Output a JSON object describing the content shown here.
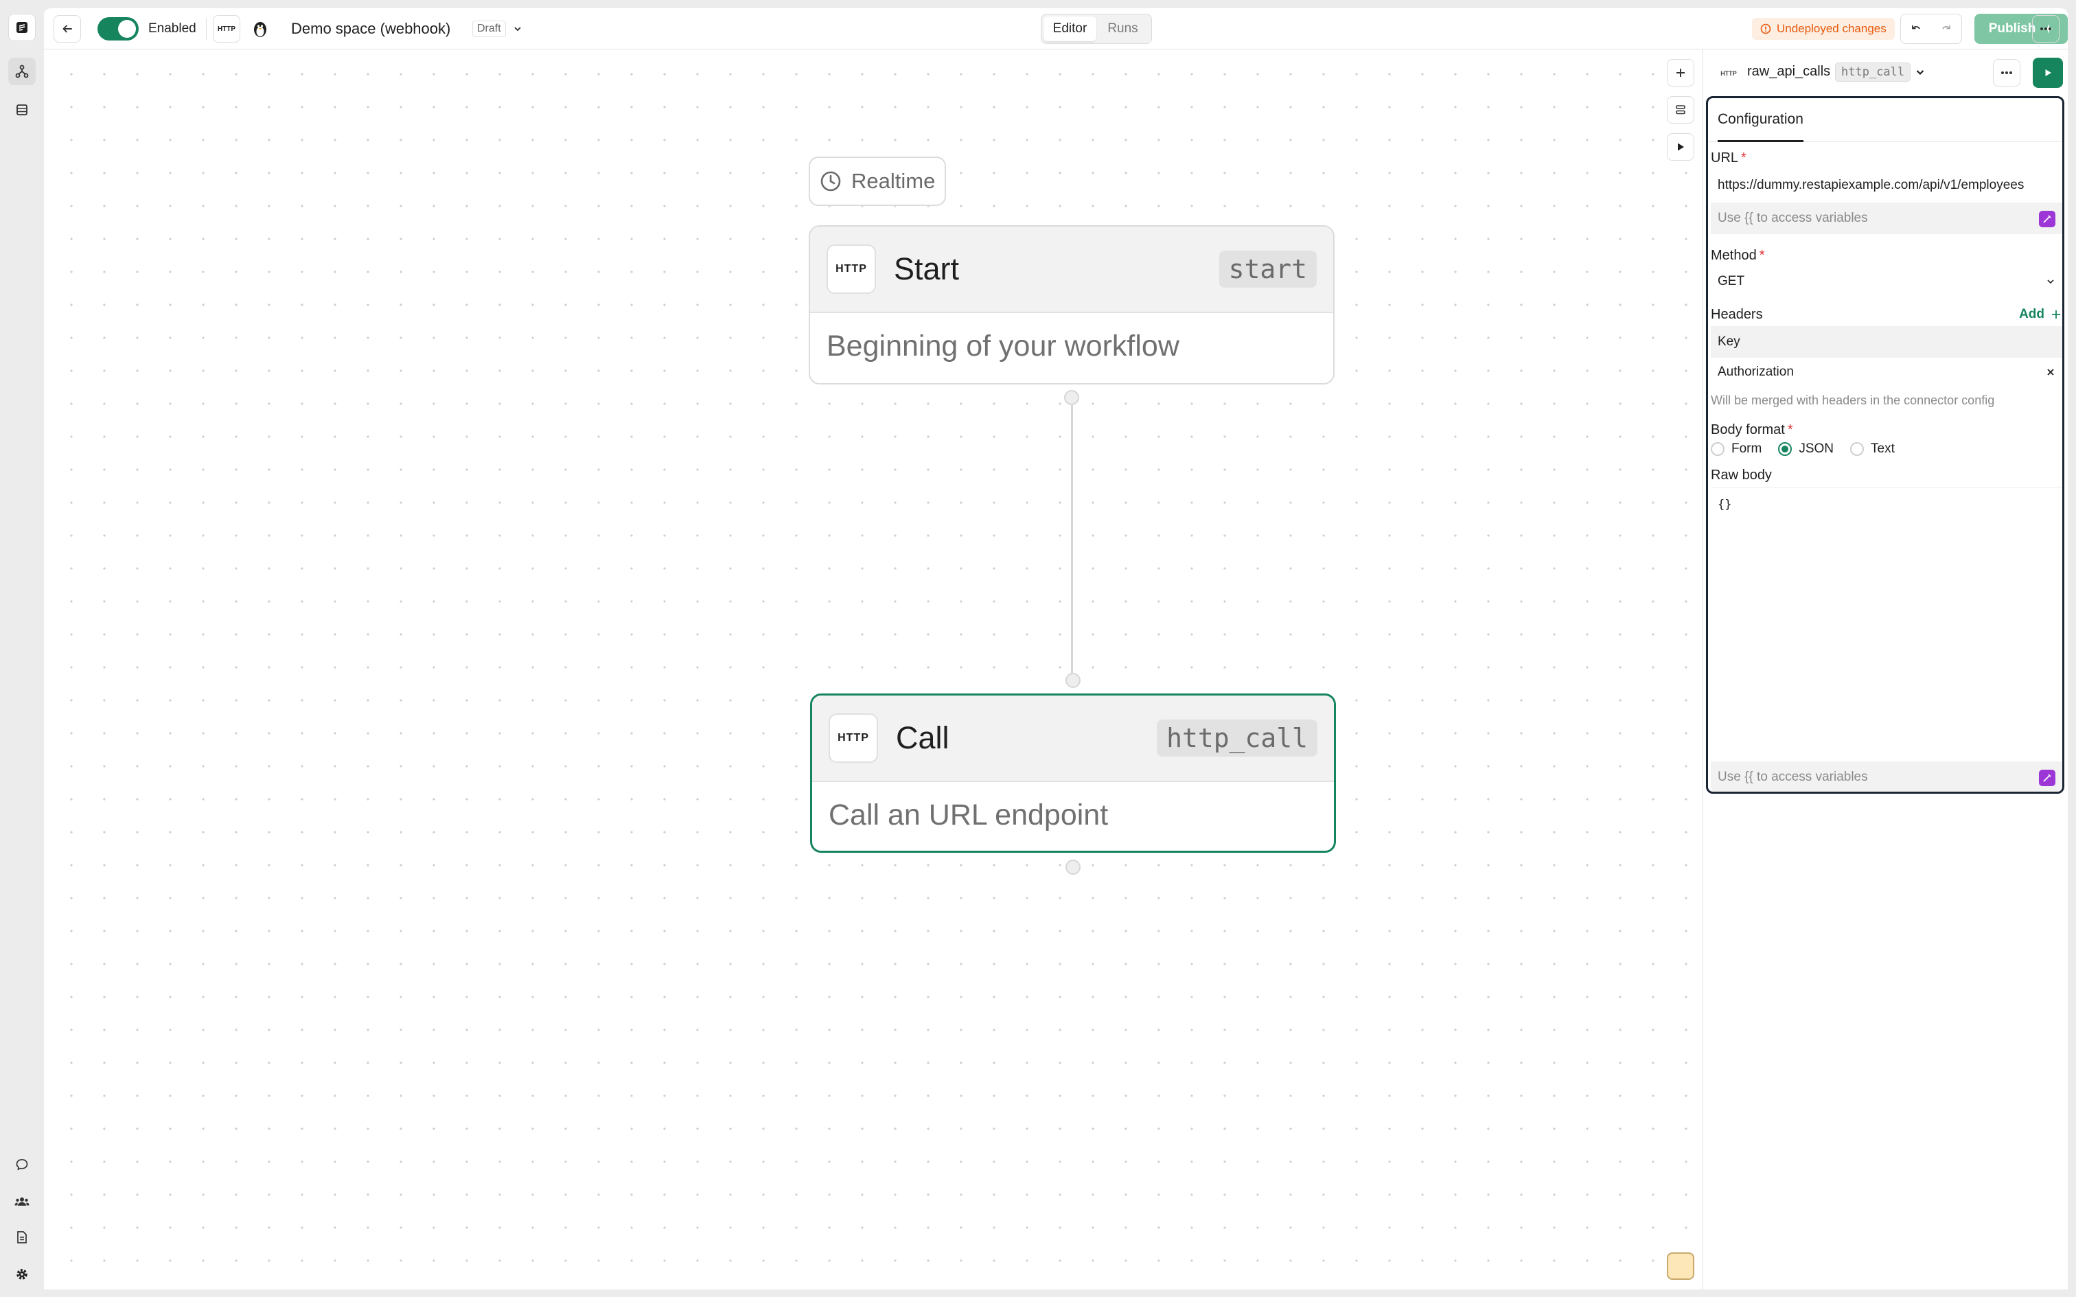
{
  "topbar": {
    "toggle_label": "Enabled",
    "trigger_badge": "HTTP",
    "workspace_title": "Demo space (webhook)",
    "status": "Draft",
    "tabs": [
      {
        "label": "Editor",
        "active": true
      },
      {
        "label": "Runs",
        "active": false
      }
    ],
    "undeployed": "Undeployed changes",
    "publish_label": "Publish"
  },
  "canvas": {
    "trigger_pill": "Realtime",
    "nodes": [
      {
        "icon_label": "HTTP",
        "title": "Start",
        "tag": "start",
        "description": "Beginning of your workflow"
      },
      {
        "icon_label": "HTTP",
        "title": "Call",
        "tag": "http_call",
        "description": "Call an URL endpoint"
      }
    ]
  },
  "panel": {
    "icon_label": "HTTP",
    "step_name": "raw_api_calls",
    "step_type": "http_call",
    "tab": "Configuration",
    "url_label": "URL",
    "url_value": "https://dummy.restapiexample.com/api/v1/employees",
    "variables_hint": "Use {{ to access variables",
    "method_label": "Method",
    "method_value": "GET",
    "headers_label": "Headers",
    "headers_add": "Add",
    "header_key_placeholder": "Key",
    "header_key_value": "Authorization",
    "headers_note": "Will be merged with headers in the connector config",
    "body_format_label": "Body format",
    "body_formats": [
      {
        "label": "Form",
        "selected": false
      },
      {
        "label": "JSON",
        "selected": true
      },
      {
        "label": "Text",
        "selected": false
      }
    ],
    "raw_body_label": "Raw body",
    "raw_body_value": "{}",
    "raw_body_hint": "Use {{ to access variables"
  },
  "colors": {
    "accent": "#16855e",
    "warning": "#e8590c",
    "magic": "#9c36d6"
  }
}
